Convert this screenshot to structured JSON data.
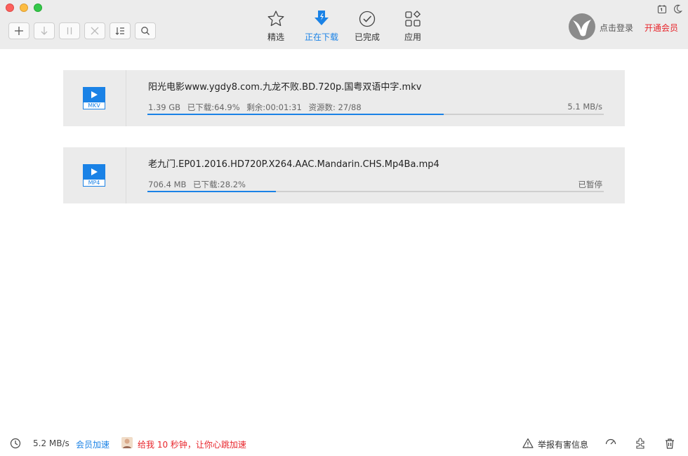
{
  "toolbar": {
    "buttons": [
      {
        "name": "new-task-button",
        "icon": "plus-icon"
      },
      {
        "name": "start-button",
        "icon": "arrow-down-icon"
      },
      {
        "name": "pause-button",
        "icon": "pause-icon"
      },
      {
        "name": "delete-button",
        "icon": "close-icon"
      },
      {
        "name": "sort-button",
        "icon": "list-sort-icon"
      },
      {
        "name": "search-button",
        "icon": "search-icon"
      }
    ]
  },
  "tabs": [
    {
      "label": "精选",
      "icon": "star-icon",
      "active": false
    },
    {
      "label": "正在下载",
      "icon": "download-icon",
      "active": true
    },
    {
      "label": "已完成",
      "icon": "check-circle-icon",
      "active": false
    },
    {
      "label": "应用",
      "icon": "apps-icon",
      "active": false
    }
  ],
  "account": {
    "login_label": "点击登录",
    "vip_label": "开通会员"
  },
  "tasks": [
    {
      "name": "阳光电影www.ygdy8.com.九龙不败.BD.720p.国粤双语中字.mkv",
      "ext": "MKV",
      "size": "1.39 GB",
      "downloaded": "已下载:64.9%",
      "remaining": "剩余:00:01:31",
      "sources": "资源数: 27/88",
      "status": "5.1 MB/s",
      "progress": 0.649
    },
    {
      "name": "老九门.EP01.2016.HD720P.X264.AAC.Mandarin.CHS.Mp4Ba.mp4",
      "ext": "MP4",
      "size": "706.4 MB",
      "downloaded": "已下载:28.2%",
      "remaining": "",
      "sources": "",
      "status": "已暂停",
      "progress": 0.282
    }
  ],
  "statusbar": {
    "speed": "5.2 MB/s",
    "vip_speedup": "会员加速",
    "promo": "给我 10 秒钟，让你心跳加速",
    "report": "举报有害信息"
  },
  "colors": {
    "accent": "#1a82e6",
    "vip_red": "#e8262c",
    "task_bg": "#ebebeb"
  }
}
